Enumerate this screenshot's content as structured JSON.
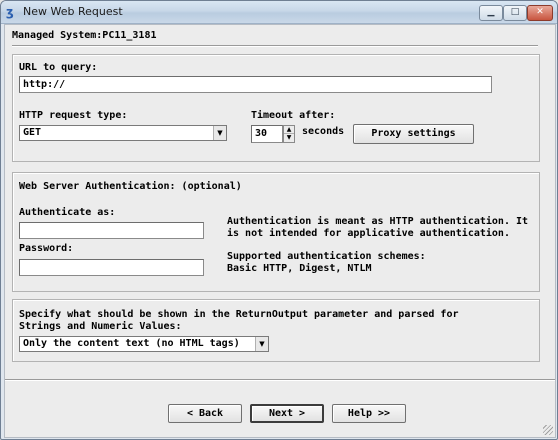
{
  "window": {
    "title": "New Web Request",
    "minimize": "▁",
    "maximize": "□",
    "close": "✕"
  },
  "managed_system": "Managed System:PC11_3181",
  "url": {
    "label": "URL to query:",
    "value": "http://"
  },
  "request_type": {
    "label": "HTTP request type:",
    "value": "GET"
  },
  "timeout": {
    "label": "Timeout after:",
    "value": "30",
    "unit": "seconds"
  },
  "proxy_button": "Proxy settings",
  "auth": {
    "heading": "Web Server Authentication: (optional)",
    "authenticate_label": "Authenticate as:",
    "authenticate_value": "",
    "password_label": "Password:",
    "password_value": "",
    "info_line1": "Authentication is meant as HTTP authentication. It",
    "info_line2": "is not intended for applicative authentication.",
    "schemes_line1": "Supported authentication schemes:",
    "schemes_line2": "Basic HTTP, Digest, NTLM"
  },
  "output": {
    "desc_line1": "Specify what should be shown in the ReturnOutput parameter and parsed for",
    "desc_line2": "Strings and Numeric Values:",
    "selected": "Only the content text (no HTML tags)"
  },
  "nav": {
    "back": "< Back",
    "next": "Next >",
    "help": "Help >>"
  }
}
